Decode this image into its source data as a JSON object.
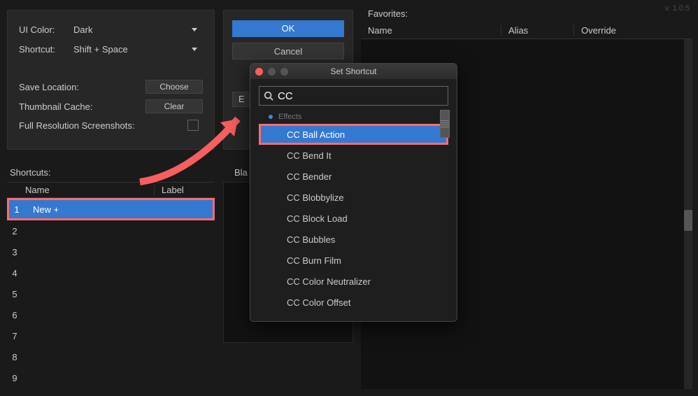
{
  "version": "v. 1.0.5",
  "settings": {
    "ui_color_label": "UI Color:",
    "ui_color_value": "Dark",
    "shortcut_label": "Shortcut:",
    "shortcut_value": "Shift + Space",
    "save_location_label": "Save Location:",
    "choose_btn": "Choose",
    "thumb_cache_label": "Thumbnail Cache:",
    "clear_btn": "Clear",
    "full_res_label": "Full Resolution Screenshots:"
  },
  "actions": {
    "ok": "OK",
    "cancel": "Cancel",
    "extra": "E"
  },
  "shortcuts": {
    "section_label": "Shortcuts:",
    "col_name": "Name",
    "col_label": "Label",
    "rows": [
      {
        "n": "1",
        "name": "New +"
      },
      {
        "n": "2",
        "name": ""
      },
      {
        "n": "3",
        "name": ""
      },
      {
        "n": "4",
        "name": ""
      },
      {
        "n": "5",
        "name": ""
      },
      {
        "n": "6",
        "name": ""
      },
      {
        "n": "7",
        "name": ""
      },
      {
        "n": "8",
        "name": ""
      },
      {
        "n": "9",
        "name": ""
      }
    ]
  },
  "blacklist_label": "Bla",
  "favorites": {
    "section_label": "Favorites:",
    "col_name": "Name",
    "col_alias": "Alias",
    "col_override": "Override"
  },
  "dialog": {
    "title": "Set Shortcut",
    "search_value": "CC",
    "group": "Effects",
    "items": [
      "CC Ball Action",
      "CC Bend It",
      "CC Bender",
      "CC Blobbylize",
      "CC Block Load",
      "CC Bubbles",
      "CC Burn Film",
      "CC Color Neutralizer",
      "CC Color Offset"
    ],
    "selected_index": 0
  }
}
